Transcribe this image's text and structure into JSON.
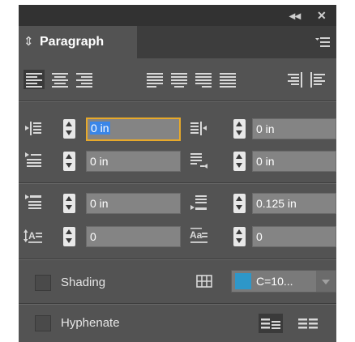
{
  "panel": {
    "title": "Paragraph",
    "controls": {
      "collapse": "◂◂",
      "close": "✕"
    }
  },
  "alignment_buttons": [
    "align-left",
    "align-center",
    "align-right",
    "justify-left",
    "justify-center",
    "justify-right",
    "justify-all",
    "align-towards-spine",
    "align-away-from-spine"
  ],
  "indents": {
    "left_indent": "0 in",
    "right_indent": "0 in",
    "first_line_indent": "0 in",
    "last_line_right_indent": "0 in"
  },
  "spacing": {
    "space_before": "0 in",
    "space_after": "0.125 in",
    "drop_cap_lines": "0",
    "drop_cap_chars": "0"
  },
  "shading": {
    "label": "Shading",
    "swatch_label": "C=10...",
    "swatch_color": "#2e97c9"
  },
  "hyphenate": {
    "label": "Hyphenate"
  },
  "colors": {
    "panel_bg": "#535353",
    "focus_border": "#e7a92a",
    "selection": "#3a86e8"
  }
}
